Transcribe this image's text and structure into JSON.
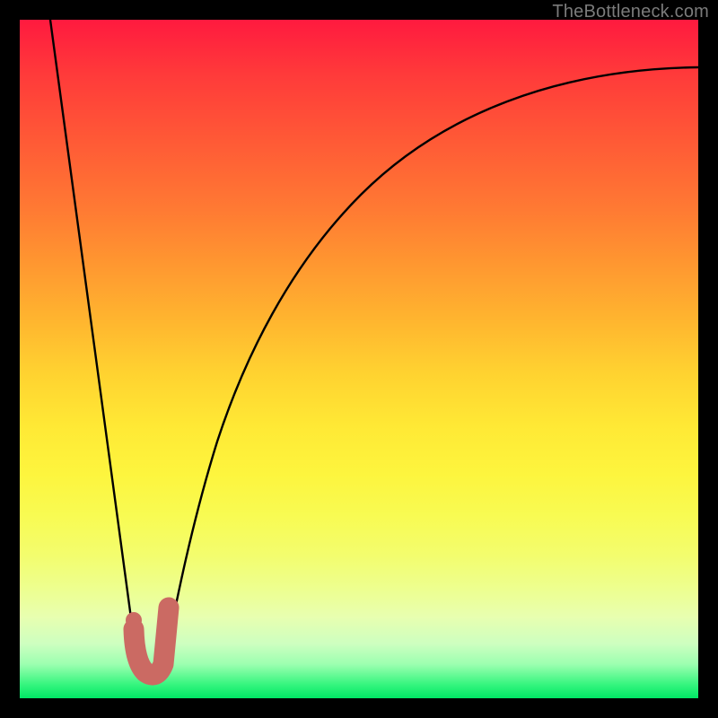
{
  "watermark": "TheBottleneck.com",
  "colors": {
    "frame": "#000000",
    "curve": "#000000",
    "marker_fill": "#cb6a63",
    "marker_stroke": "#cb6a63"
  },
  "chart_data": {
    "type": "line",
    "title": "",
    "xlabel": "",
    "ylabel": "",
    "xlim": [
      0,
      100
    ],
    "ylim": [
      0,
      100
    ],
    "grid": false,
    "legend": false,
    "series": [
      {
        "name": "left-descent",
        "x": [
          4.5,
          17.5
        ],
        "y": [
          100,
          4
        ],
        "stroke": "#000000"
      },
      {
        "name": "right-ascent",
        "x": [
          21,
          23,
          25,
          27,
          30,
          34,
          38,
          43,
          50,
          58,
          68,
          80,
          90,
          100
        ],
        "y": [
          4,
          15,
          25,
          33,
          43,
          53,
          60,
          67,
          74,
          80,
          85,
          89,
          91.5,
          93
        ],
        "stroke": "#000000"
      }
    ],
    "marker": {
      "name": "J-marker",
      "shape": "J",
      "center_x": 19,
      "center_y": 6,
      "path_points": [
        {
          "x": 16.8,
          "y": 11.5
        },
        {
          "x": 16.8,
          "y": 10.2
        },
        {
          "x": 17.3,
          "y": 5.3
        },
        {
          "x": 18.6,
          "y": 3.6
        },
        {
          "x": 20.3,
          "y": 3.6
        },
        {
          "x": 21.4,
          "y": 5.0
        },
        {
          "x": 21.9,
          "y": 13.3
        }
      ],
      "stroke_width_pct": 3.2,
      "color": "#cb6a63"
    }
  }
}
